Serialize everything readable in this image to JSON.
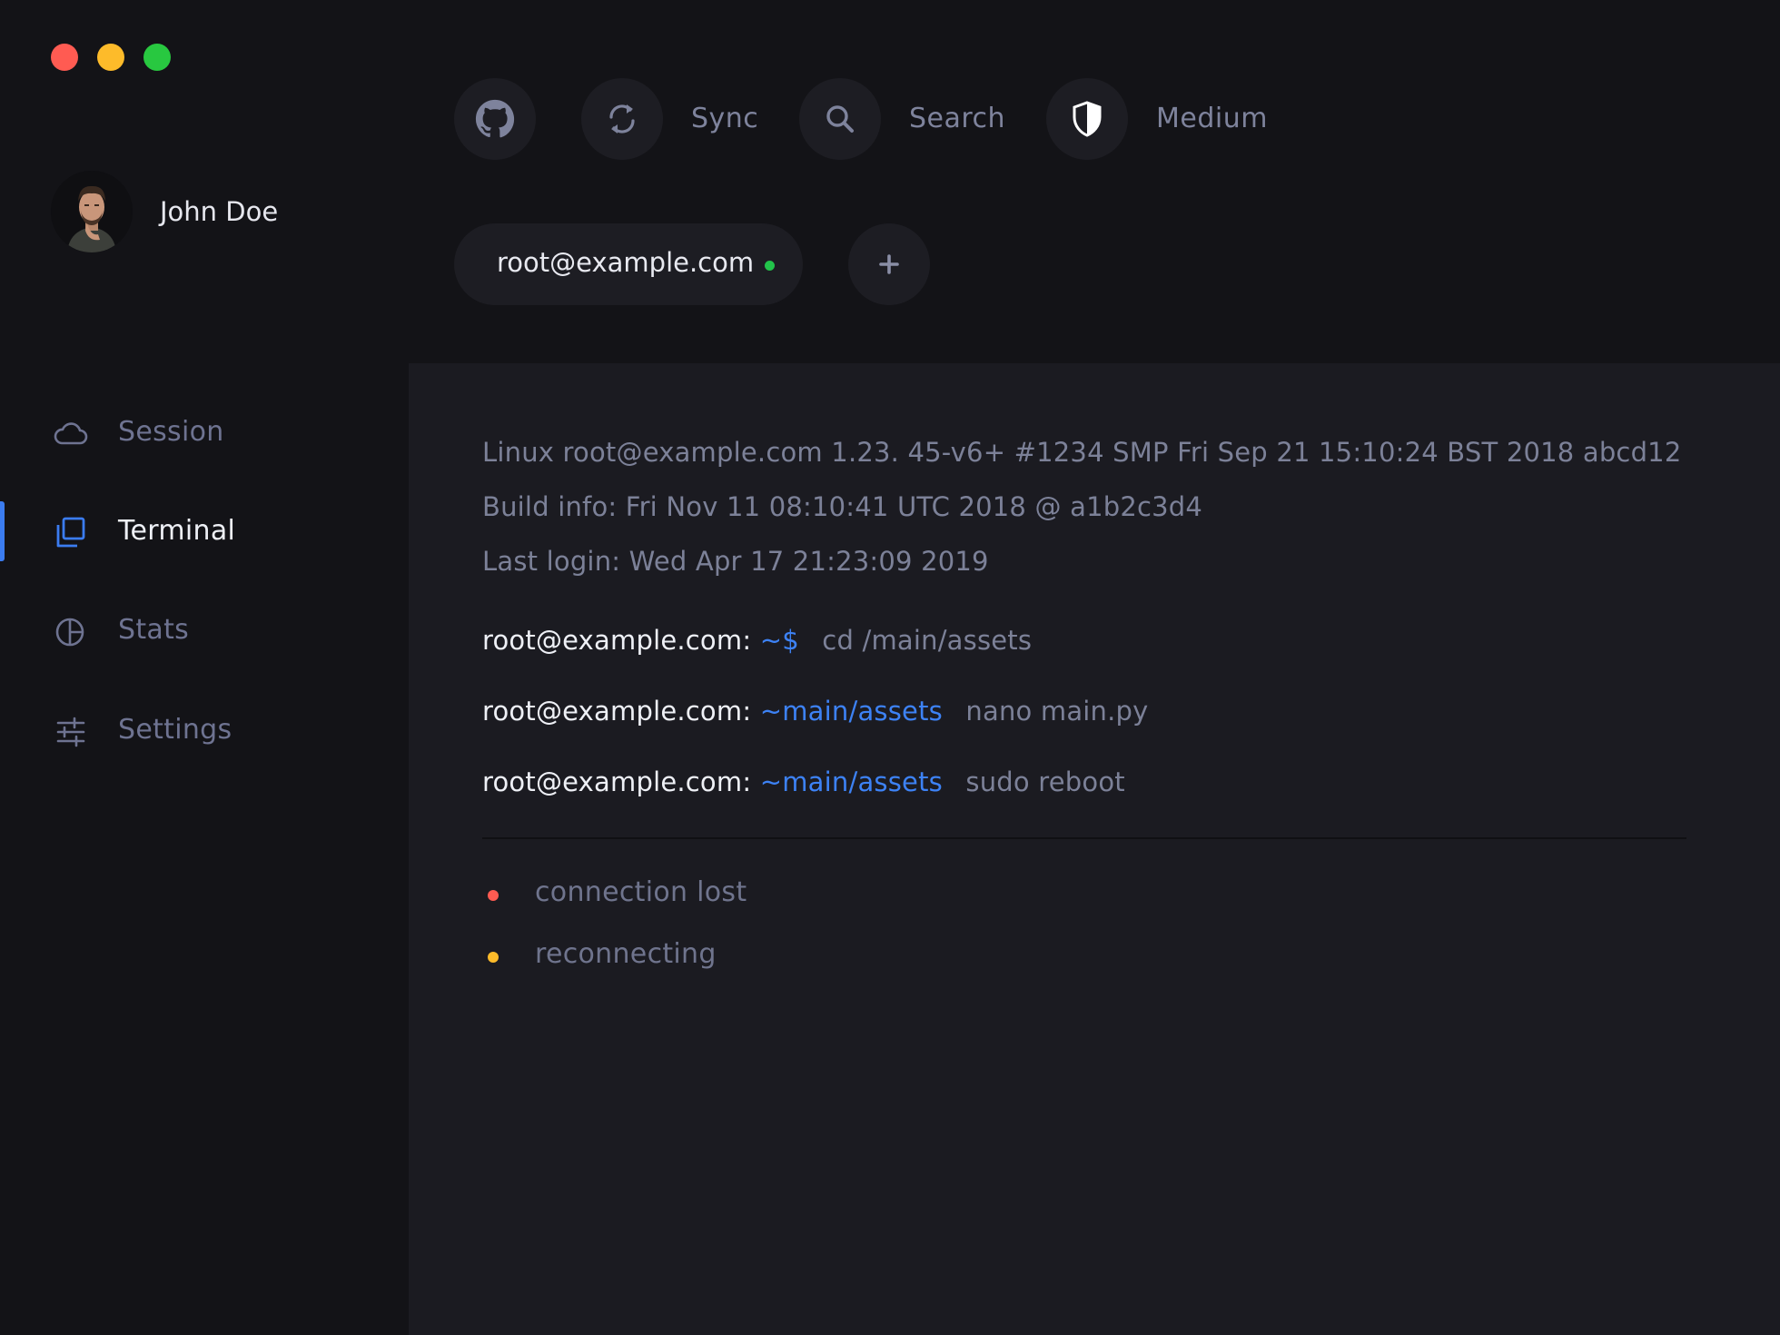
{
  "window": {
    "controls": [
      "close",
      "minimize",
      "maximize"
    ],
    "colors": {
      "close": "#ff5b52",
      "minimize": "#fdbb2a",
      "maximize": "#28c840"
    }
  },
  "profile": {
    "name": "John Doe"
  },
  "sidebar": {
    "items": [
      {
        "label": "Session",
        "icon": "cloud-icon",
        "active": false
      },
      {
        "label": "Terminal",
        "icon": "terminal-window-icon",
        "active": true
      },
      {
        "label": "Stats",
        "icon": "pie-chart-icon",
        "active": false
      },
      {
        "label": "Settings",
        "icon": "sliders-icon",
        "active": false
      }
    ],
    "accent": "#3b7cf0"
  },
  "toolbar": {
    "github_icon": "github-icon",
    "sync_label": "Sync",
    "search_label": "Search",
    "security_label": "Medium"
  },
  "tabs": {
    "host": "root@example.com",
    "host_status_color": "#22c34a",
    "add_icon": "plus-icon"
  },
  "terminal": {
    "system_lines": [
      "Linux root@example.com 1.23. 45-v6+ #1234 SMP Fri Sep 21 15:10:24 BST 2018 abcd12",
      "Build info: Fri Nov 11 08:10:41 UTC 2018 @ a1b2c3d4",
      "Last login: Wed Apr 17 21:23:09 2019"
    ],
    "commands": [
      {
        "host": "root@example.com:",
        "path": "~$",
        "command": "cd /main/assets"
      },
      {
        "host": "root@example.com:",
        "path": "~main/assets",
        "command": "nano main.py"
      },
      {
        "host": "root@example.com:",
        "path": "~main/assets",
        "command": "sudo reboot"
      }
    ],
    "status": [
      {
        "text": "connection lost",
        "color": "#ff5b52"
      },
      {
        "text": "reconnecting",
        "color": "#fdbb2a"
      }
    ]
  }
}
